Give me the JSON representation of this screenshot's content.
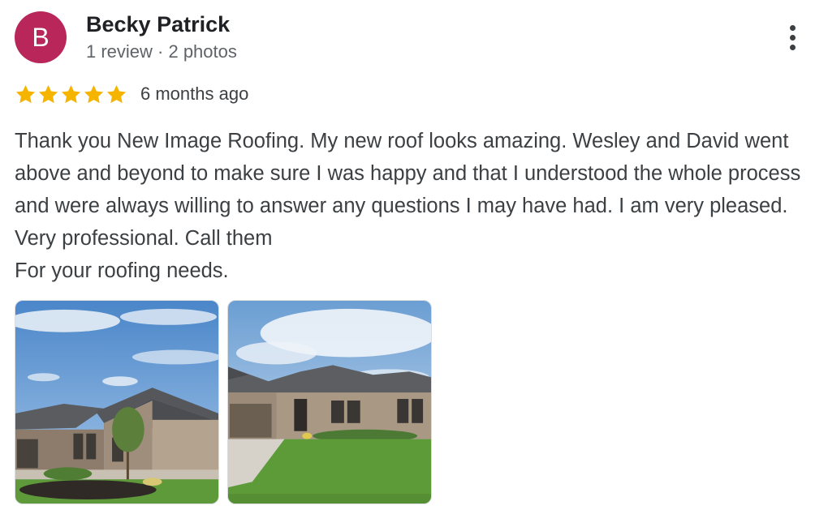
{
  "reviewer": {
    "avatar_initial": "B",
    "avatar_color": "#b8265a",
    "name": "Becky Patrick",
    "meta": "1 review · 2 photos"
  },
  "rating": {
    "stars": 5,
    "max": 5,
    "star_color": "#f4b400",
    "time_ago": "6 months ago"
  },
  "review_text": "Thank you New Image Roofing. My new roof looks amazing. Wesley and David went above and beyond to make sure I was happy and that I understood the whole process and were always willing to answer any questions I may have had. I am very pleased. Very professional. Call them\nFor your roofing needs.",
  "more_menu_icon": "more-vert-icon",
  "photos": [
    {
      "label": "house-photo-1"
    },
    {
      "label": "house-photo-2"
    }
  ]
}
